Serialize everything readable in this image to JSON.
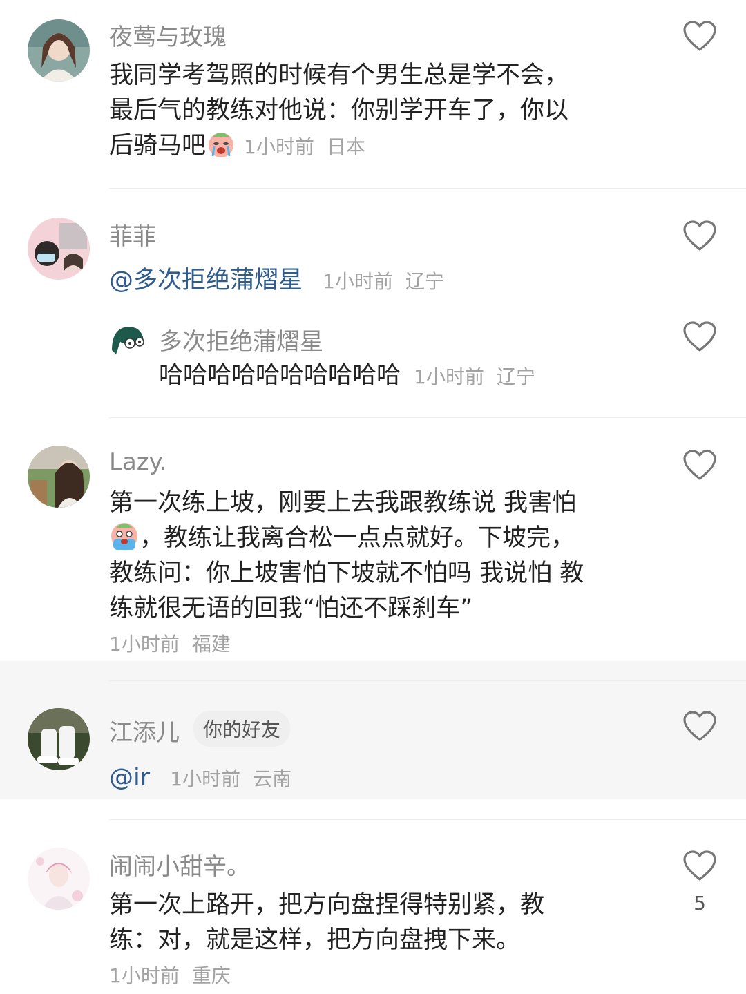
{
  "comments": [
    {
      "name": "夜莺与玫瑰",
      "text_a": "我同学考驾照的时候有个男生总是学不会，",
      "text_b": "最后气的教练对他说：你别学开车了，你以",
      "text_c": "后骑马吧",
      "emoji": "crying-face-emoji",
      "time": "1小时前",
      "location": "日本"
    },
    {
      "name": "菲菲",
      "mention": "@多次拒绝蒲熠星",
      "time": "1小时前",
      "location": "辽宁",
      "reply": {
        "name": "多次拒绝蒲熠星",
        "text": "哈哈哈哈哈哈哈哈哈哈",
        "time": "1小时前",
        "location": "辽宁"
      }
    },
    {
      "name": "Lazy.",
      "line1": "第一次练上坡，刚要上去我跟教练说 我害怕",
      "line2": "，教练让我离合松一点点就好。下坡完，",
      "line3": "教练问：你上坡害怕下坡就不怕吗 我说怕 教",
      "line4": "练就很无语的回我“怕还不踩刹车”",
      "emoji": "scared-face-emoji",
      "time": "1小时前",
      "location": "福建"
    },
    {
      "name": "江添儿",
      "badge": "你的好友",
      "mention": "@ir",
      "time": "1小时前",
      "location": "云南"
    },
    {
      "name": "闹闹小甜辛。",
      "line1": "第一次上路开，把方向盘捏得特别紧，教",
      "line2": "练：对，就是这样，把方向盘拽下来。",
      "time": "1小时前",
      "location": "重庆",
      "likes": "5"
    }
  ],
  "colors": {
    "name": "#8a8a8a",
    "text": "#222222",
    "meta": "#a3a3a3",
    "mention": "#2f5c8f",
    "highlight_bg": "#f6f6f6"
  }
}
